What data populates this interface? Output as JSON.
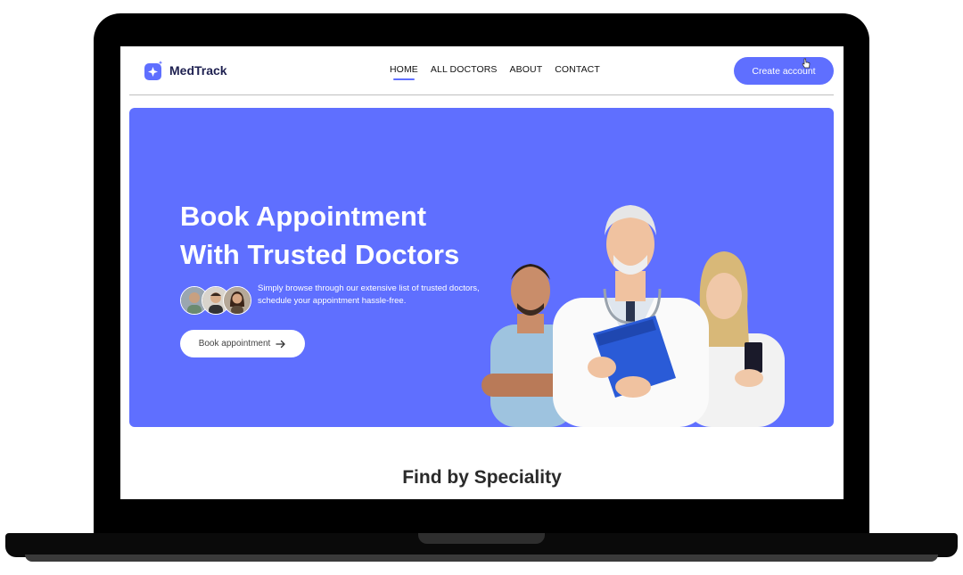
{
  "brand": {
    "name": "MedTrack",
    "color": "#5f6fff"
  },
  "nav": {
    "items": [
      {
        "label": "HOME",
        "active": true
      },
      {
        "label": "ALL DOCTORS",
        "active": false
      },
      {
        "label": "ABOUT",
        "active": false
      },
      {
        "label": "CONTACT",
        "active": false
      }
    ],
    "cta_label": "Create account"
  },
  "hero": {
    "title_line1": "Book Appointment",
    "title_line2": "With Trusted Doctors",
    "desc_line1": "Simply browse through our extensive list of trusted doctors,",
    "desc_line2": "schedule your appointment hassle-free.",
    "button_label": "Book appointment",
    "button_icon": "arrow-right-icon",
    "bg_color": "#5f6fff"
  },
  "section": {
    "title": "Find by Speciality"
  }
}
